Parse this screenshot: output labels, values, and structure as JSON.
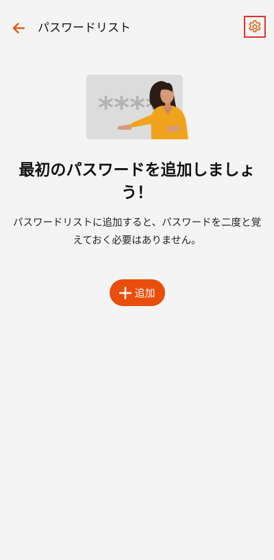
{
  "header": {
    "title": "パスワードリスト",
    "back_icon": "arrow-left-icon",
    "settings_icon": "gear-icon"
  },
  "illustration": {
    "text": "****"
  },
  "empty_state": {
    "heading": "最初のパスワードを追加しましょう！",
    "description": "パスワードリストに追加すると、パスワードを二度と覚えておく必要はありません。"
  },
  "add_button": {
    "label": "追加",
    "icon": "plus-icon"
  },
  "colors": {
    "accent": "#ea4e0d",
    "background": "#f4f4f4",
    "highlight_border": "#e0312b"
  }
}
